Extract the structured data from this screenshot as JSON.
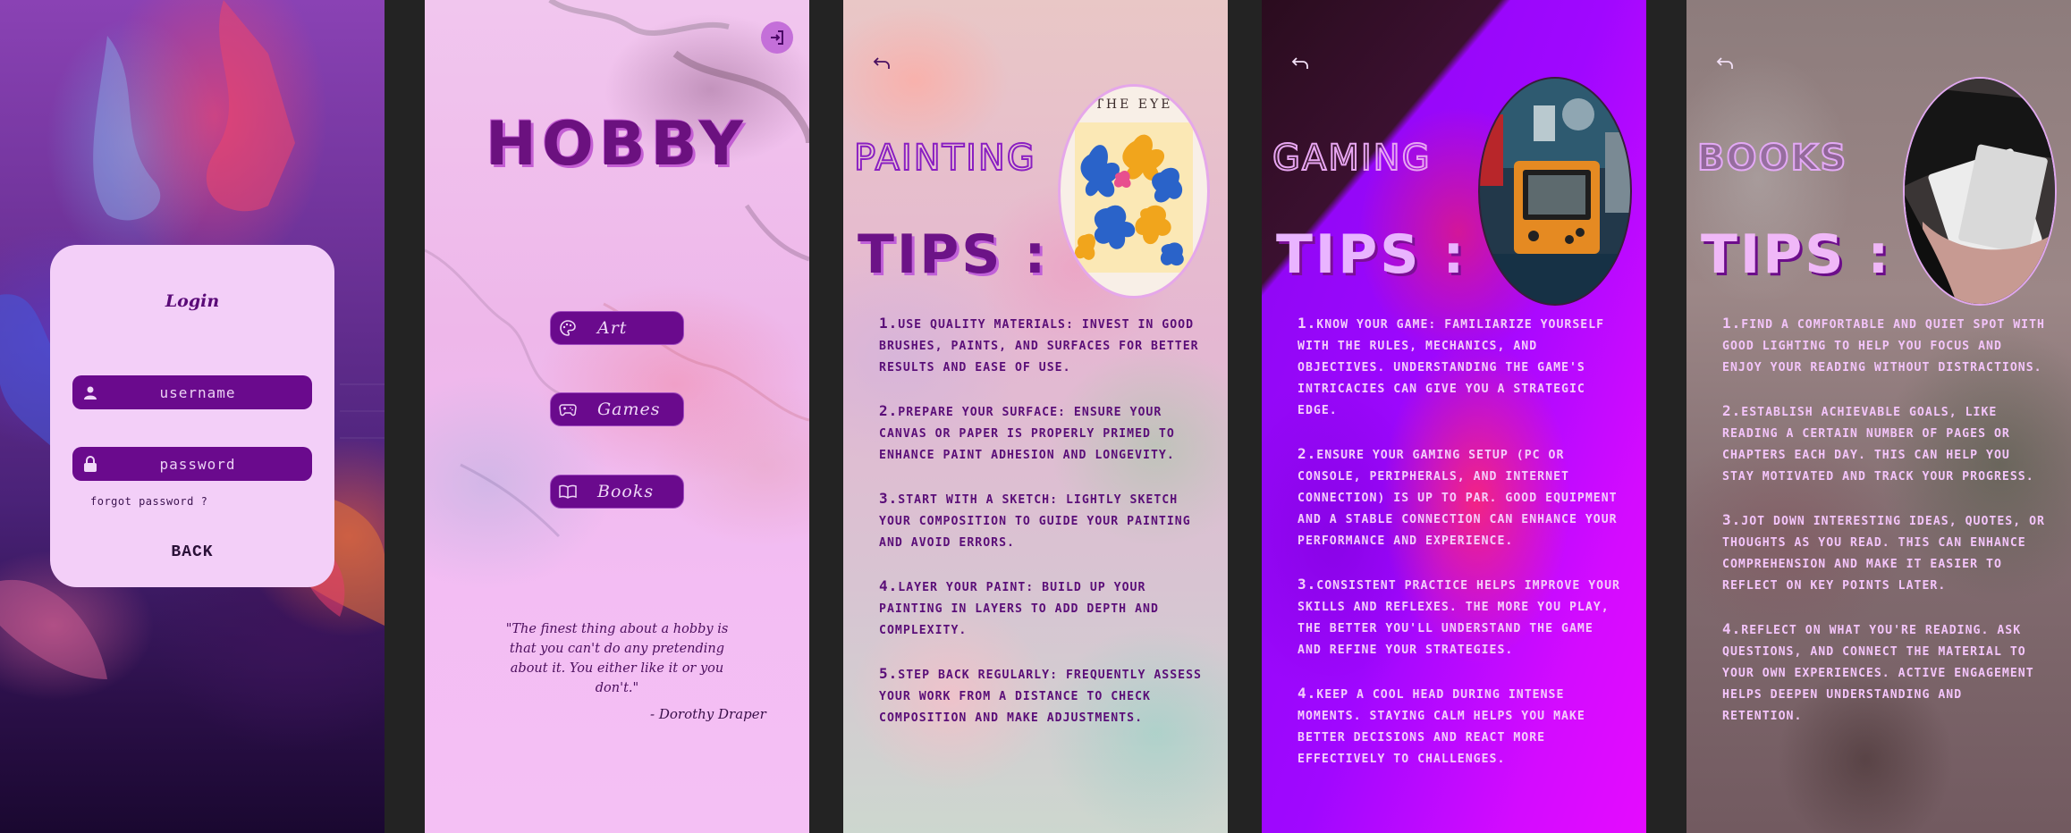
{
  "login": {
    "title": "Login",
    "username_placeholder": "username",
    "password_placeholder": "password",
    "forgot": "forgot password ?",
    "back": "BACK"
  },
  "hobby": {
    "title": "HOBBY",
    "menu": [
      {
        "label": "Art",
        "icon": "palette-icon"
      },
      {
        "label": "Games",
        "icon": "gamepad-icon"
      },
      {
        "label": "Books",
        "icon": "book-icon"
      }
    ],
    "quote": "\"The finest thing about a hobby is that you can't do any pretending about it. You either like it or you don't.\"",
    "quote_author": "- Dorothy Draper"
  },
  "painting": {
    "category": "PAINTING",
    "tips_title": "TIPS :",
    "image_caption": "THE EYE",
    "tips": [
      {
        "num": "1.",
        "text": "USE QUALITY MATERIALS: INVEST IN GOOD BRUSHES, PAINTS, AND SURFACES FOR BETTER RESULTS AND EASE OF USE."
      },
      {
        "num": "2.",
        "text": "PREPARE YOUR SURFACE: ENSURE YOUR CANVAS OR PAPER IS PROPERLY PRIMED TO ENHANCE PAINT ADHESION AND LONGEVITY."
      },
      {
        "num": "3.",
        "text": "START WITH A SKETCH: LIGHTLY SKETCH YOUR COMPOSITION TO GUIDE YOUR PAINTING AND AVOID ERRORS."
      },
      {
        "num": "4.",
        "text": "LAYER YOUR PAINT: BUILD UP YOUR PAINTING IN LAYERS TO ADD DEPTH AND COMPLEXITY."
      },
      {
        "num": "5.",
        "text": "STEP BACK REGULARLY: FREQUENTLY ASSESS YOUR WORK FROM A DISTANCE TO CHECK COMPOSITION AND MAKE ADJUSTMENTS."
      }
    ]
  },
  "gaming": {
    "category": "GAMING",
    "tips_title": "TIPS :",
    "tips": [
      {
        "num": "1.",
        "text": "KNOW YOUR GAME: FAMILIARIZE YOURSELF WITH THE RULES, MECHANICS, AND OBJECTIVES. UNDERSTANDING THE GAME'S INTRICACIES CAN GIVE YOU A STRATEGIC EDGE."
      },
      {
        "num": "2.",
        "text": "ENSURE YOUR GAMING SETUP (PC OR CONSOLE, PERIPHERALS, AND INTERNET CONNECTION) IS UP TO PAR. GOOD EQUIPMENT AND A STABLE CONNECTION CAN ENHANCE YOUR PERFORMANCE AND EXPERIENCE."
      },
      {
        "num": "3.",
        "text": "CONSISTENT PRACTICE HELPS IMPROVE YOUR SKILLS AND REFLEXES. THE MORE YOU PLAY, THE BETTER YOU'LL UNDERSTAND THE GAME AND REFINE YOUR STRATEGIES."
      },
      {
        "num": "4.",
        "text": "KEEP A COOL HEAD DURING INTENSE MOMENTS. STAYING CALM HELPS YOU MAKE BETTER DECISIONS AND REACT MORE EFFECTIVELY TO CHALLENGES."
      }
    ]
  },
  "books": {
    "category": "BOOKS",
    "tips_title": "TIPS :",
    "tips": [
      {
        "num": "1.",
        "text": "FIND A COMFORTABLE AND QUIET SPOT WITH GOOD LIGHTING TO HELP YOU FOCUS AND ENJOY YOUR READING WITHOUT DISTRACTIONS."
      },
      {
        "num": "2.",
        "text": "ESTABLISH ACHIEVABLE GOALS, LIKE READING A CERTAIN NUMBER OF PAGES OR CHAPTERS EACH DAY. THIS CAN HELP YOU STAY MOTIVATED AND TRACK YOUR PROGRESS."
      },
      {
        "num": "3.",
        "text": "JOT DOWN INTERESTING IDEAS, QUOTES, OR THOUGHTS AS YOU READ. THIS CAN ENHANCE COMPREHENSION AND MAKE IT EASIER TO REFLECT ON KEY POINTS LATER."
      },
      {
        "num": "4.",
        "text": "REFLECT ON WHAT YOU'RE READING. ASK QUESTIONS, AND CONNECT THE MATERIAL TO YOUR OWN EXPERIENCES. ACTIVE ENGAGEMENT HELPS DEEPEN UNDERSTANDING AND RETENTION."
      }
    ]
  },
  "colors": {
    "primary_purple": "#6a0a8d",
    "card_pink": "#f3cff8",
    "hobby_bg": "#f1c6ee"
  }
}
